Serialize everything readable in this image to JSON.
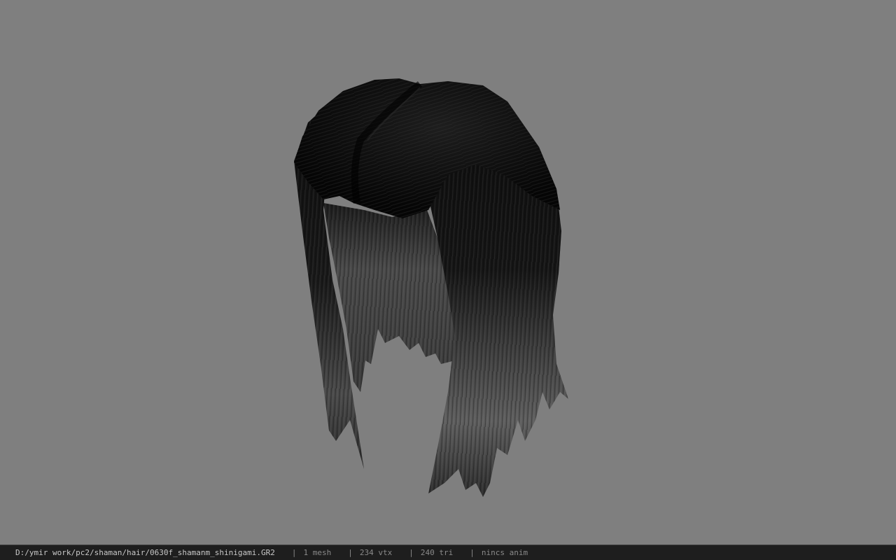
{
  "viewport": {
    "background_color": "#7f7f7f",
    "model_icon": "hair-mesh-model"
  },
  "statusbar": {
    "file_path": "D:/ymir work/pc2/shaman/hair/0630f_shamanm_shinigami.GR2",
    "separator": "|",
    "mesh_count": "1 mesh",
    "vertex_count": "234 vtx",
    "triangle_count": "240 tri",
    "anim_status": "nincs anim"
  }
}
